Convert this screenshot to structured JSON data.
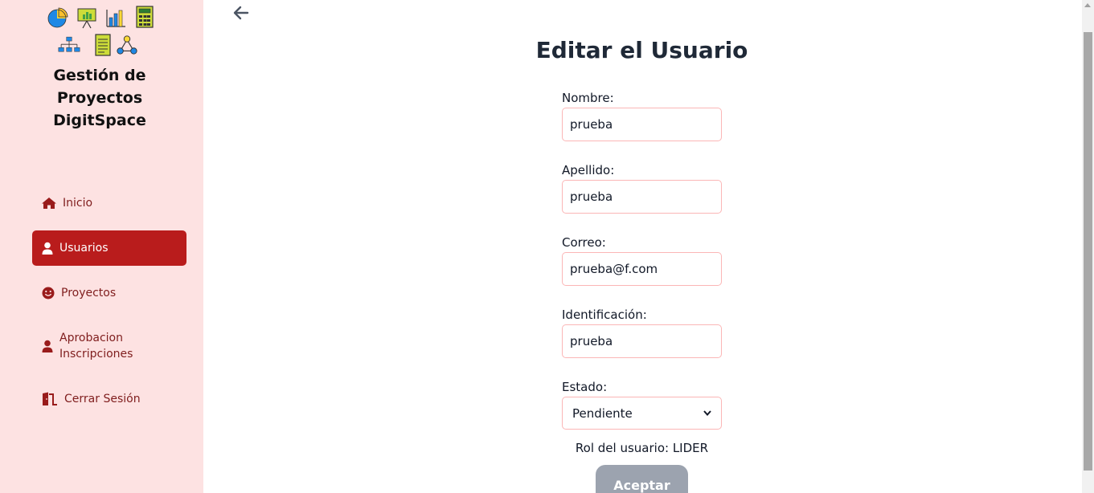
{
  "sidebar": {
    "brand_line1": "Gestión de",
    "brand_line2": "Proyectos",
    "brand_line3": "DigitSpace",
    "logo_icons": [
      "pie-chart-icon",
      "presentation-board-icon",
      "bar-chart-icon",
      "calculator-icon",
      "org-chart-icon",
      "document-icon",
      "network-icon"
    ],
    "items": [
      {
        "label": "Inicio",
        "icon": "home-icon"
      },
      {
        "label": "Usuarios",
        "icon": "user-icon",
        "active": true
      },
      {
        "label": "Proyectos",
        "icon": "smile-icon"
      },
      {
        "label_line1": "Aprobacion",
        "label_line2": "Inscripciones",
        "icon": "user-icon"
      },
      {
        "label": "Cerrar Sesión",
        "icon": "door-exit-icon"
      }
    ]
  },
  "main": {
    "back_icon": "arrow-left-icon",
    "title": "Editar el Usuario",
    "fields": {
      "nombre": {
        "label": "Nombre:",
        "value": "prueba"
      },
      "apellido": {
        "label": "Apellido:",
        "value": "prueba"
      },
      "correo": {
        "label": "Correo:",
        "value": "prueba@f.com"
      },
      "identificacion": {
        "label": "Identificación:",
        "value": "prueba"
      },
      "estado": {
        "label": "Estado:",
        "selected": "Pendiente"
      }
    },
    "role_text": "Rol del usuario: LIDER",
    "submit_label": "Aceptar"
  },
  "colors": {
    "sidebar_bg": "#fde2e2",
    "active_bg": "#b91c1c",
    "nav_text": "#7f1d1d",
    "input_border": "#fbb6b6",
    "button_disabled": "#9ca3af"
  }
}
